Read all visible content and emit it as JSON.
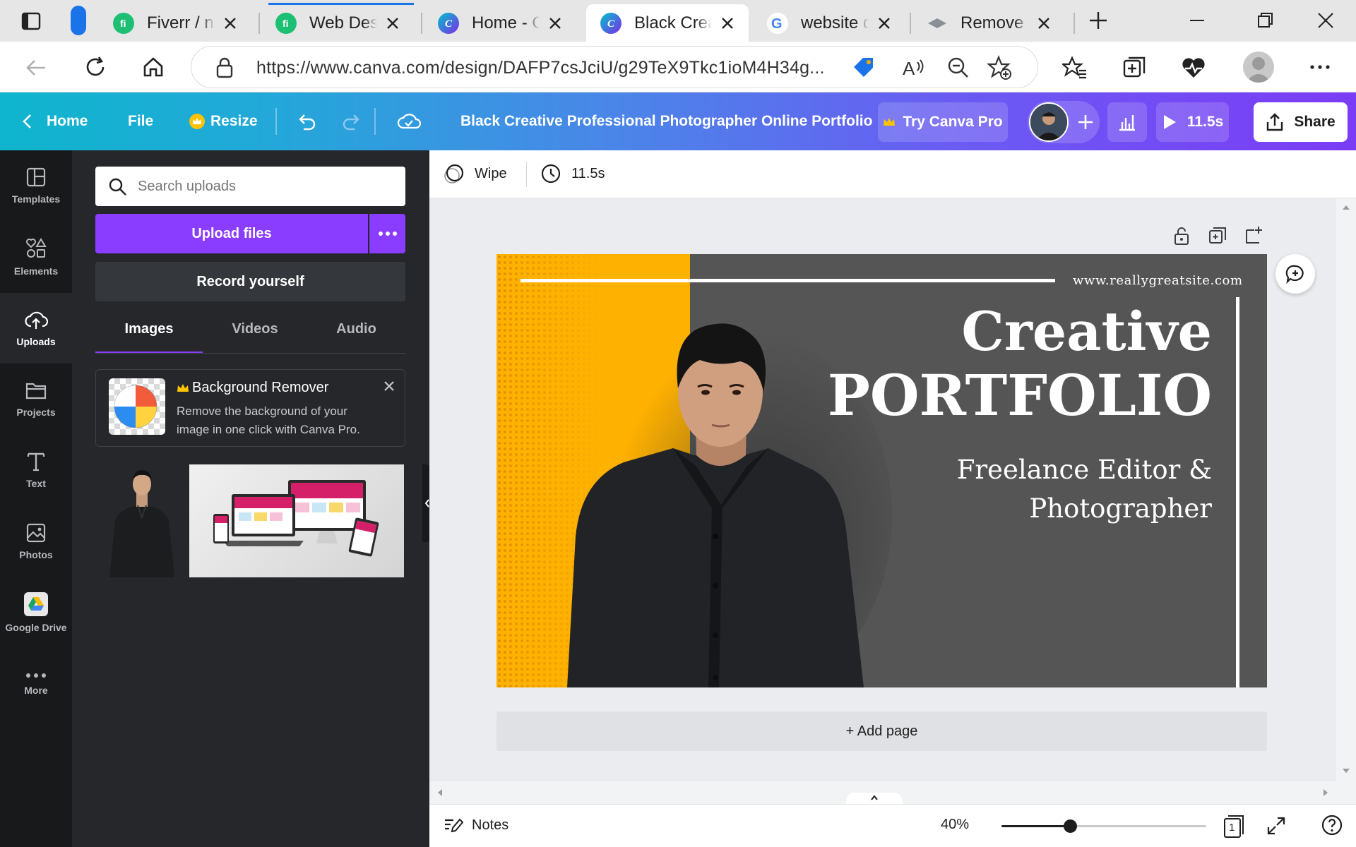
{
  "browser": {
    "tabs": [
      {
        "title": "Fiverr / ne",
        "favicon": "fiverr-icon",
        "favicon_color": "#1dbf73"
      },
      {
        "title": "Web Desig",
        "favicon": "fiverr-icon",
        "favicon_color": "#1dbf73"
      },
      {
        "title": "Home - Ca",
        "favicon": "canva-icon",
        "favicon_color": "#7d2ae8"
      },
      {
        "title": "Black Creat",
        "favicon": "canva-icon",
        "favicon_color": "#7d2ae8"
      },
      {
        "title": "website de",
        "favicon": "google-icon",
        "favicon_color": "#4285f4"
      },
      {
        "title": "Remove Ba",
        "favicon": "removebg-icon",
        "favicon_color": "#8a8f95"
      }
    ],
    "active_tab_index": 3,
    "url": "https://www.canva.com/design/DAFP7csJciU/g29TeX9Tkc1ioM4H34g..."
  },
  "canva_header": {
    "home": "Home",
    "file": "File",
    "resize": "Resize",
    "doc_title": "Black Creative Professional Photographer Online Portfolio",
    "try_pro": "Try Canva Pro",
    "play_duration": "11.5s",
    "share": "Share"
  },
  "rail": [
    {
      "label": "Templates",
      "icon": "templates-icon"
    },
    {
      "label": "Elements",
      "icon": "elements-icon"
    },
    {
      "label": "Uploads",
      "icon": "uploads-icon"
    },
    {
      "label": "Projects",
      "icon": "projects-icon"
    },
    {
      "label": "Text",
      "icon": "text-icon"
    },
    {
      "label": "Photos",
      "icon": "photos-icon"
    },
    {
      "label": "Google Drive",
      "icon": "google-drive-icon"
    },
    {
      "label": "More",
      "icon": "more-icon"
    }
  ],
  "panel": {
    "search_placeholder": "Search uploads",
    "upload_files": "Upload files",
    "record_yourself": "Record yourself",
    "tabs": [
      "Images",
      "Videos",
      "Audio"
    ],
    "bg_remover": {
      "title": "Background Remover",
      "desc_line1": "Remove the background of your",
      "desc_line2": "image in one click with Canva Pro."
    }
  },
  "editor": {
    "transition": "Wipe",
    "duration": "11.5s",
    "add_page": "+ Add page",
    "notes": "Notes",
    "zoom": "40%",
    "zoom_level": 0.4,
    "page_count": "1"
  },
  "design": {
    "website": "www.reallygreatsite.com",
    "heading1": "Creative",
    "heading2": "PORTFOLIO",
    "sub1": "Freelance Editor &",
    "sub2": "Photographer",
    "colors": {
      "bg": "#555555",
      "accent": "#ffb100",
      "text": "#ffffff"
    }
  }
}
